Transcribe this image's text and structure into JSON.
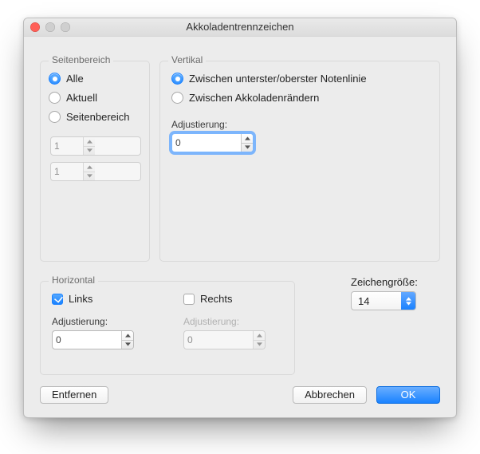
{
  "window": {
    "title": "Akkoladentrennzeichen"
  },
  "pageRange": {
    "groupTitle": "Seitenbereich",
    "options": {
      "all": "Alle",
      "current": "Aktuell",
      "range": "Seitenbereich"
    },
    "selected": "all",
    "from": "1",
    "to": "1"
  },
  "vertical": {
    "groupTitle": "Vertikal",
    "options": {
      "betweenLines": "Zwischen unterster/oberster Notenlinie",
      "betweenMargins": "Zwischen Akkoladenrändern"
    },
    "selected": "betweenLines",
    "adjustLabel": "Adjustierung:",
    "adjustValue": "0"
  },
  "horizontal": {
    "groupTitle": "Horizontal",
    "leftLabel": "Links",
    "rightLabel": "Rechts",
    "leftChecked": true,
    "rightChecked": false,
    "adjustLabelLeft": "Adjustierung:",
    "adjustValueLeft": "0",
    "adjustLabelRight": "Adjustierung:",
    "adjustValueRight": "0"
  },
  "charSize": {
    "label": "Zeichengröße:",
    "value": "14"
  },
  "buttons": {
    "remove": "Entfernen",
    "cancel": "Abbrechen",
    "ok": "OK"
  }
}
